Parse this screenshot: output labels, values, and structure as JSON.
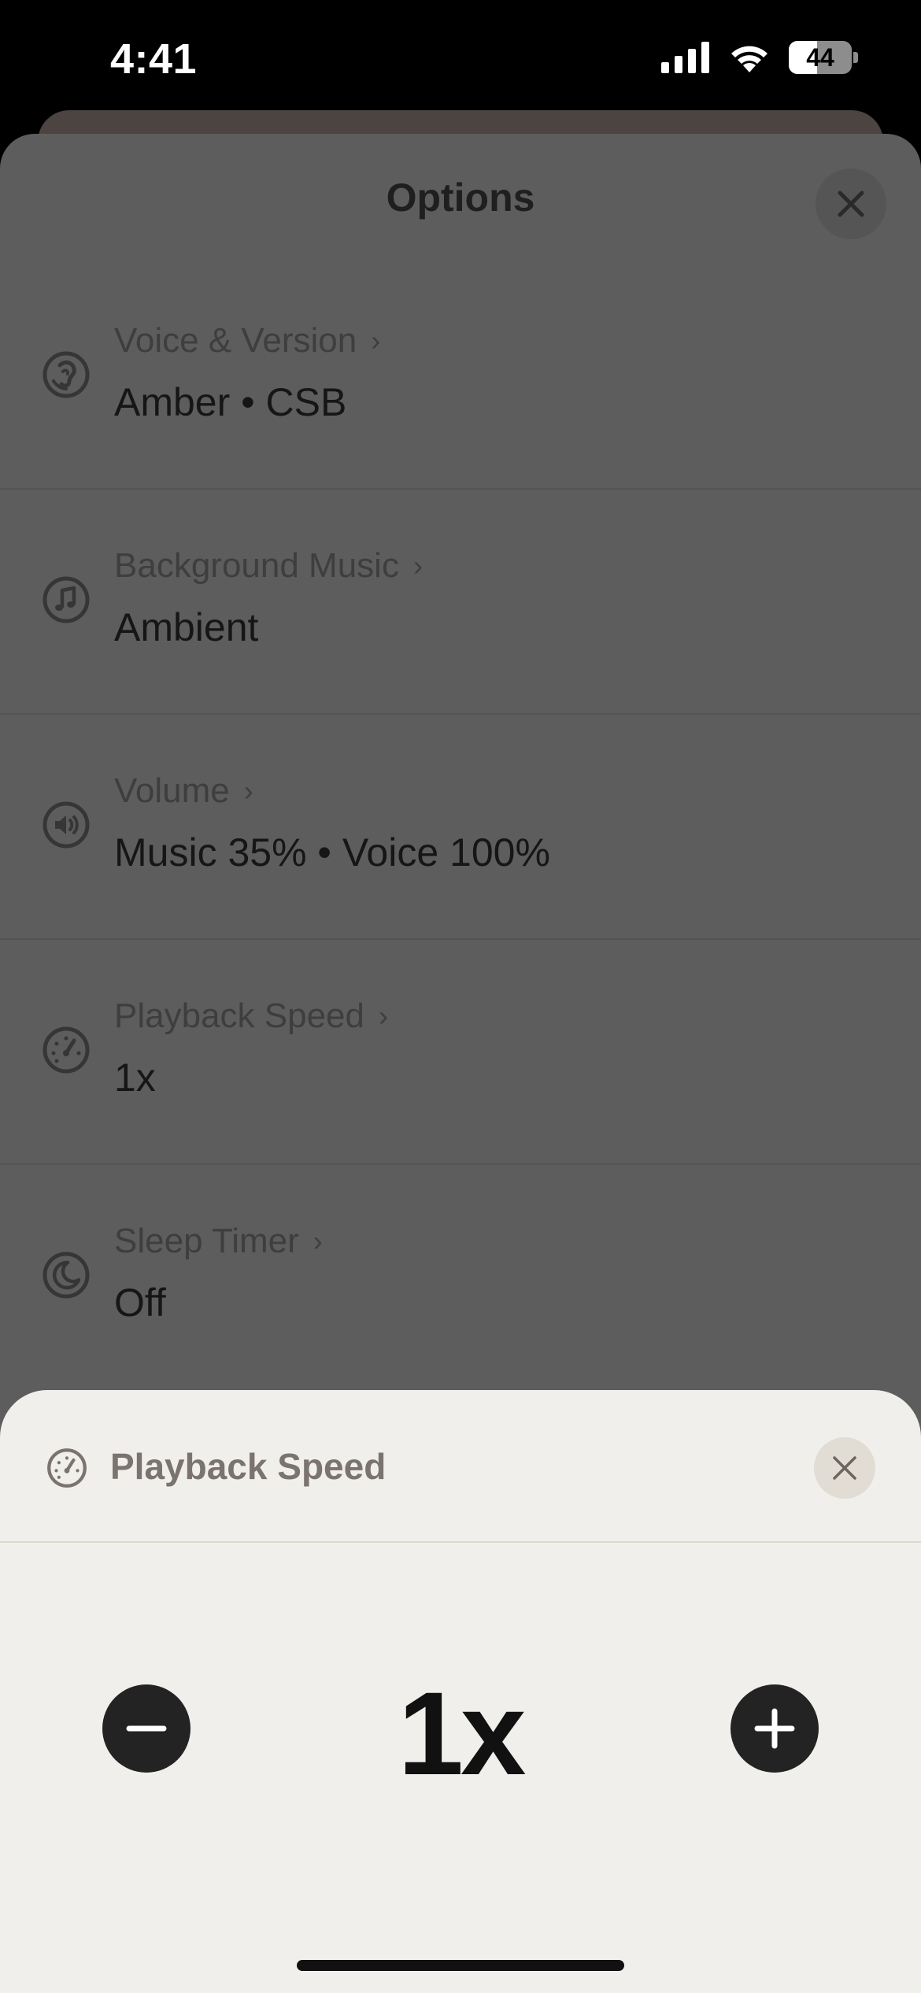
{
  "status_bar": {
    "time": "4:41",
    "battery": "44"
  },
  "options": {
    "title": "Options",
    "rows": [
      {
        "label": "Voice & Version",
        "value": "Amber • CSB",
        "icon": "voice-icon"
      },
      {
        "label": "Background Music",
        "value": "Ambient",
        "icon": "music-note-icon"
      },
      {
        "label": "Volume",
        "value": "Music 35% • Voice 100%",
        "icon": "speaker-icon"
      },
      {
        "label": "Playback Speed",
        "value": "1x",
        "icon": "speedometer-icon"
      },
      {
        "label": "Sleep Timer",
        "value": "Off",
        "icon": "moon-icon"
      }
    ]
  },
  "speed_sheet": {
    "title": "Playback Speed",
    "value": "1x"
  },
  "colors": {
    "sheet_bg": "#f1efeb",
    "dim_bg": "#5d5d5d",
    "button_bg": "#232323"
  }
}
